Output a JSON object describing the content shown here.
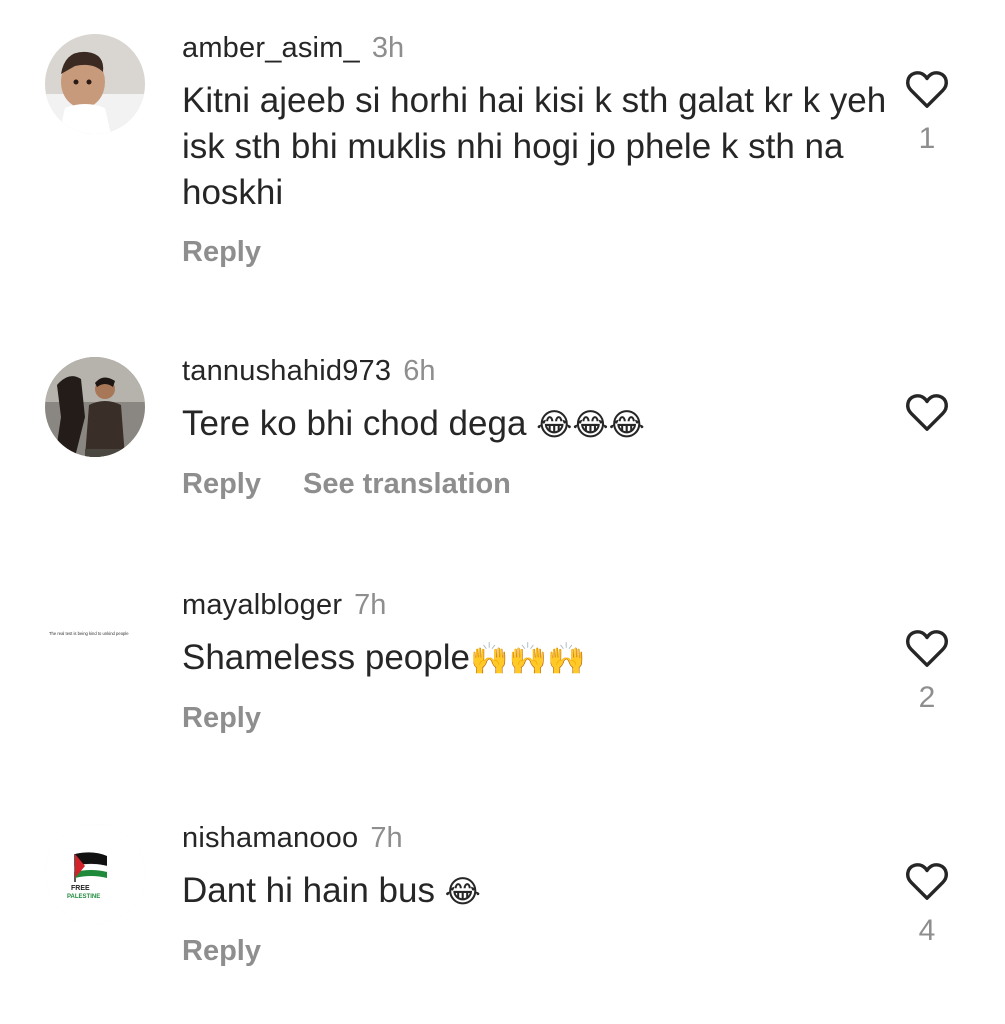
{
  "comments": [
    {
      "username": "amber_asim_",
      "time": "3h",
      "text": "Kitni ajeeb si horhi hai kisi k sth galat kr k yeh isk sth bhi muklis nhi hogi jo phele k sth na hoskhi",
      "emoji": "",
      "reply_label": "Reply",
      "translate_label": "",
      "like_count": "1"
    },
    {
      "username": "tannushahid973",
      "time": "6h",
      "text": "Tere ko bhi chod dega ",
      "emoji": "😂😂😂",
      "reply_label": "Reply",
      "translate_label": "See translation",
      "like_count": ""
    },
    {
      "username": "mayalbloger",
      "time": "7h",
      "text": "Shameless people",
      "emoji": "🙌🙌🙌",
      "reply_label": "Reply",
      "translate_label": "",
      "like_count": "2"
    },
    {
      "username": "nishamanooo",
      "time": "7h",
      "text": "Dant hi hain bus ",
      "emoji": "😂",
      "reply_label": "Reply",
      "translate_label": "",
      "like_count": "4"
    }
  ],
  "avatar_text": {
    "mayal": "The real test is being kind to unkind people",
    "nisha_line1": "FREE",
    "nisha_line2": "PALESTINE"
  },
  "icons": {
    "like": "heart-outline-icon"
  },
  "colors": {
    "text": "#262626",
    "muted": "#8e8e8e"
  }
}
